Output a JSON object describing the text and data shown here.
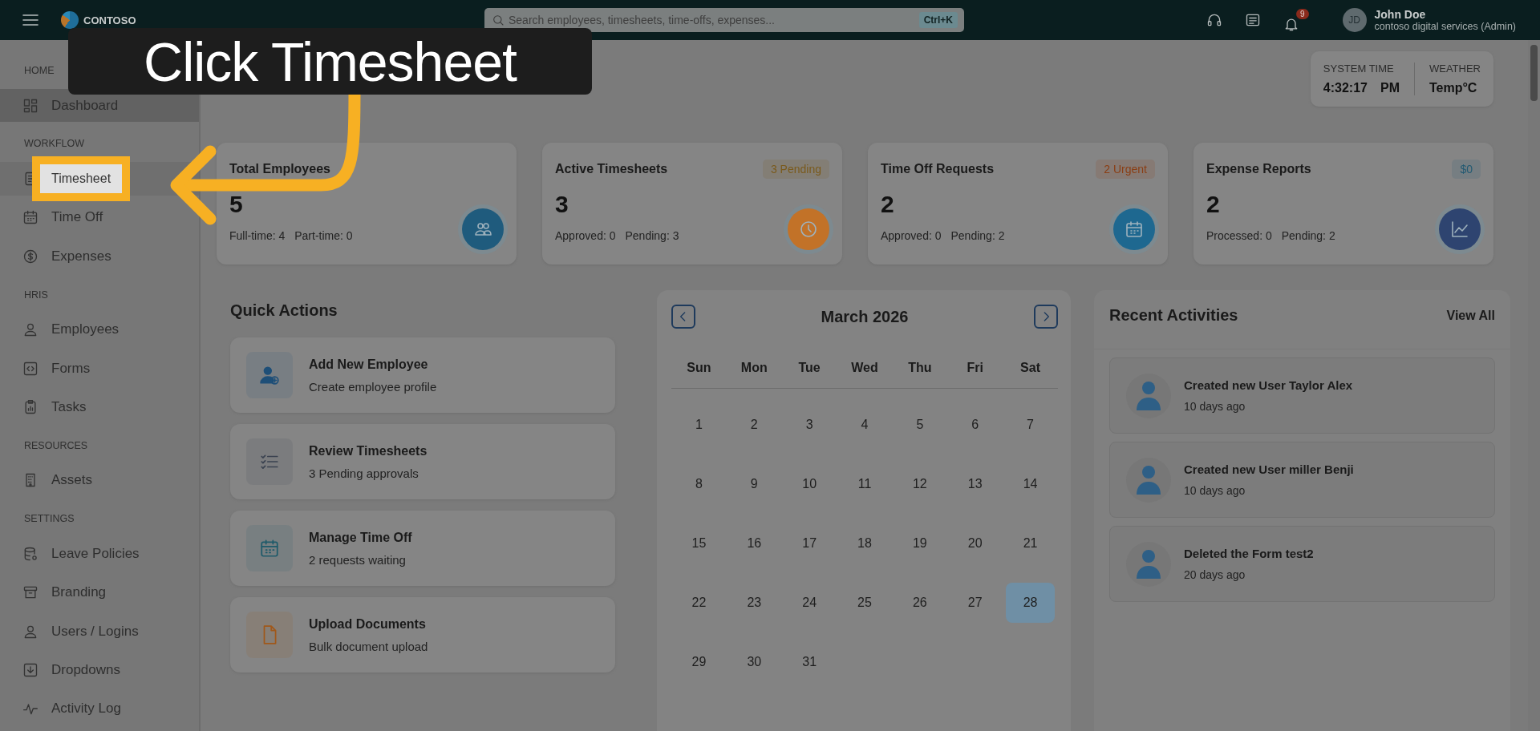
{
  "topbar": {
    "logo": "CONTOSO",
    "search": {
      "placeholder": "Search employees, timesheets, time-offs, expenses...",
      "shortcut": "Ctrl+K"
    },
    "notifications": "9",
    "user": {
      "initials": "JD",
      "name": "John Doe",
      "role": "contoso digital services (Admin)"
    }
  },
  "sidebar": {
    "sections": [
      {
        "heading": "HOME",
        "items": [
          {
            "label": "Dashboard",
            "selected": true,
            "highlighted": false
          }
        ]
      },
      {
        "heading": "WORKFLOW",
        "items": [
          {
            "label": "Timesheet",
            "selected": false,
            "highlighted": true
          },
          {
            "label": "Time Off",
            "selected": false,
            "highlighted": false
          },
          {
            "label": "Expenses",
            "selected": false,
            "highlighted": false
          }
        ]
      },
      {
        "heading": "HRIS",
        "items": [
          {
            "label": "Employees",
            "selected": false,
            "highlighted": false
          },
          {
            "label": "Forms",
            "selected": false,
            "highlighted": false
          },
          {
            "label": "Tasks",
            "selected": false,
            "highlighted": false
          }
        ]
      },
      {
        "heading": "RESOURCES",
        "items": [
          {
            "label": "Assets",
            "selected": false,
            "highlighted": false
          }
        ]
      },
      {
        "heading": "SETTINGS",
        "items": [
          {
            "label": "Leave Policies",
            "selected": false,
            "highlighted": false
          },
          {
            "label": "Branding",
            "selected": false,
            "highlighted": false
          },
          {
            "label": "Users / Logins",
            "selected": false,
            "highlighted": false
          },
          {
            "label": "Dropdowns",
            "selected": false,
            "highlighted": false
          },
          {
            "label": "Activity Log",
            "selected": false,
            "highlighted": false
          }
        ]
      }
    ]
  },
  "system_info": {
    "time_label": "SYSTEM TIME",
    "time": "4:32:17",
    "period": "PM",
    "weather_label": "WEATHER",
    "weather": "Temp°C"
  },
  "stats": [
    {
      "title": "Total Employees",
      "value": "5",
      "details": [
        "Full-time: 4",
        "Part-time: 0"
      ],
      "color": "#1f5b7d"
    },
    {
      "title": "Active Timesheets",
      "badge": {
        "text": "3 Pending",
        "color": "#7a5a1c"
      },
      "value": "3",
      "details": [
        "Approved: 0",
        "Pending: 3"
      ],
      "color": "#c27228"
    },
    {
      "title": "Time Off Requests",
      "badge": {
        "text": "2 Urgent",
        "color": "#8a3e14"
      },
      "value": "2",
      "details": [
        "Approved: 0",
        "Pending: 2"
      ],
      "color": "#1e6890"
    },
    {
      "title": "Expense Reports",
      "badge": {
        "text": "$0",
        "color": "#235a72"
      },
      "value": "2",
      "details": [
        "Processed: 0",
        "Pending: 2"
      ],
      "color": "#2e4470"
    }
  ],
  "quick_actions": {
    "title": "Quick Actions",
    "items": [
      {
        "title": "Add New Employee",
        "subtitle": "Create employee profile",
        "color": "#1e4f78"
      },
      {
        "title": "Review Timesheets",
        "subtitle": "3 Pending approvals",
        "color": "#3a4250"
      },
      {
        "title": "Manage Time Off",
        "subtitle": "2 requests waiting",
        "color": "#1e5a6a"
      },
      {
        "title": "Upload Documents",
        "subtitle": "Bulk document upload",
        "color": "#a0581a"
      }
    ]
  },
  "calendar": {
    "title": "March 2026",
    "weekdays": [
      "Sun",
      "Mon",
      "Tue",
      "Wed",
      "Thu",
      "Fri",
      "Sat"
    ],
    "days": [
      {
        "label": "1",
        "selected": false
      },
      {
        "label": "2",
        "selected": false
      },
      {
        "label": "3",
        "selected": false
      },
      {
        "label": "4",
        "selected": false
      },
      {
        "label": "5",
        "selected": false
      },
      {
        "label": "6",
        "selected": false
      },
      {
        "label": "7",
        "selected": false
      },
      {
        "label": "8",
        "selected": false
      },
      {
        "label": "9",
        "selected": false
      },
      {
        "label": "10",
        "selected": false
      },
      {
        "label": "11",
        "selected": false
      },
      {
        "label": "12",
        "selected": false
      },
      {
        "label": "13",
        "selected": false
      },
      {
        "label": "14",
        "selected": false
      },
      {
        "label": "15",
        "selected": false
      },
      {
        "label": "16",
        "selected": false
      },
      {
        "label": "17",
        "selected": false
      },
      {
        "label": "18",
        "selected": false
      },
      {
        "label": "19",
        "selected": false
      },
      {
        "label": "20",
        "selected": false
      },
      {
        "label": "21",
        "selected": false
      },
      {
        "label": "22",
        "selected": false
      },
      {
        "label": "23",
        "selected": false
      },
      {
        "label": "24",
        "selected": false
      },
      {
        "label": "25",
        "selected": false
      },
      {
        "label": "26",
        "selected": false
      },
      {
        "label": "27",
        "selected": false
      },
      {
        "label": "28",
        "selected": true
      },
      {
        "label": "29",
        "selected": false
      },
      {
        "label": "30",
        "selected": false
      },
      {
        "label": "31",
        "selected": false
      }
    ]
  },
  "recent_activities": {
    "title": "Recent Activities",
    "link": "View All",
    "items": [
      {
        "text": "Created new User Taylor Alex",
        "time": "10 days ago"
      },
      {
        "text": "Created new User miller Benji",
        "time": "10 days ago"
      },
      {
        "text": "Deleted the Form test2",
        "time": "20 days ago"
      }
    ]
  },
  "callout": {
    "text": "Click Timesheet"
  }
}
